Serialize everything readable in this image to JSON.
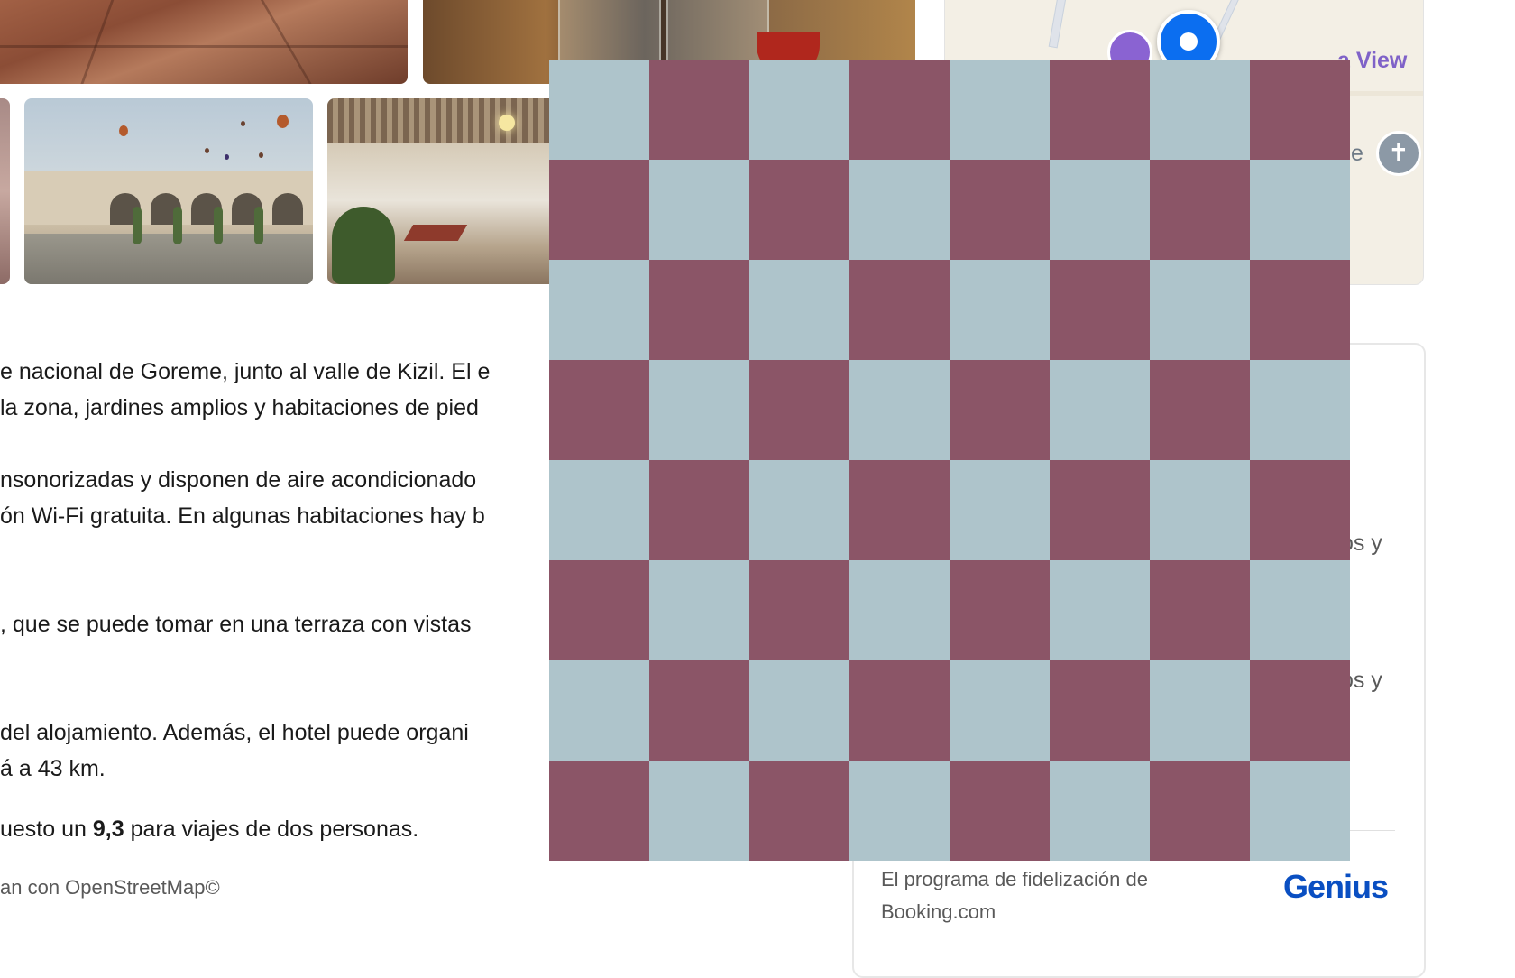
{
  "description": {
    "lines": [
      "e nacional de Goreme, junto al valle de Kizil. El e",
      " la zona, jardines amplios y habitaciones de pied",
      "nsonorizadas y disponen de aire acondicionado",
      "ón Wi-Fi gratuita. En algunas habitaciones hay b",
      ", que se puede tomar en una terraza con vistas",
      " del alojamiento. Además, el hotel puede organi",
      "á a 43 km."
    ],
    "rating_prefix": "uesto un ",
    "rating_value": "9,3",
    "rating_suffix": " para viajes de dos personas.",
    "osm_credit": "an con OpenStreetMap©"
  },
  "map": {
    "view_label": "a View",
    "e_label": "e",
    "church_icon": "✝"
  },
  "card": {
    "partial_text_1": "os y",
    "partial_text_2": "os y",
    "genius_description": "El programa de fidelización de Booking.com",
    "genius_logo": "Genius"
  },
  "checker": {
    "rows": 8,
    "cols": 8,
    "color_light": "#aec4cb",
    "color_dark": "#8b5567"
  },
  "colors": {
    "genius_blue": "#0a4fc2",
    "map_pin_blue": "#0b6ef0",
    "text_grey": "#595959"
  }
}
